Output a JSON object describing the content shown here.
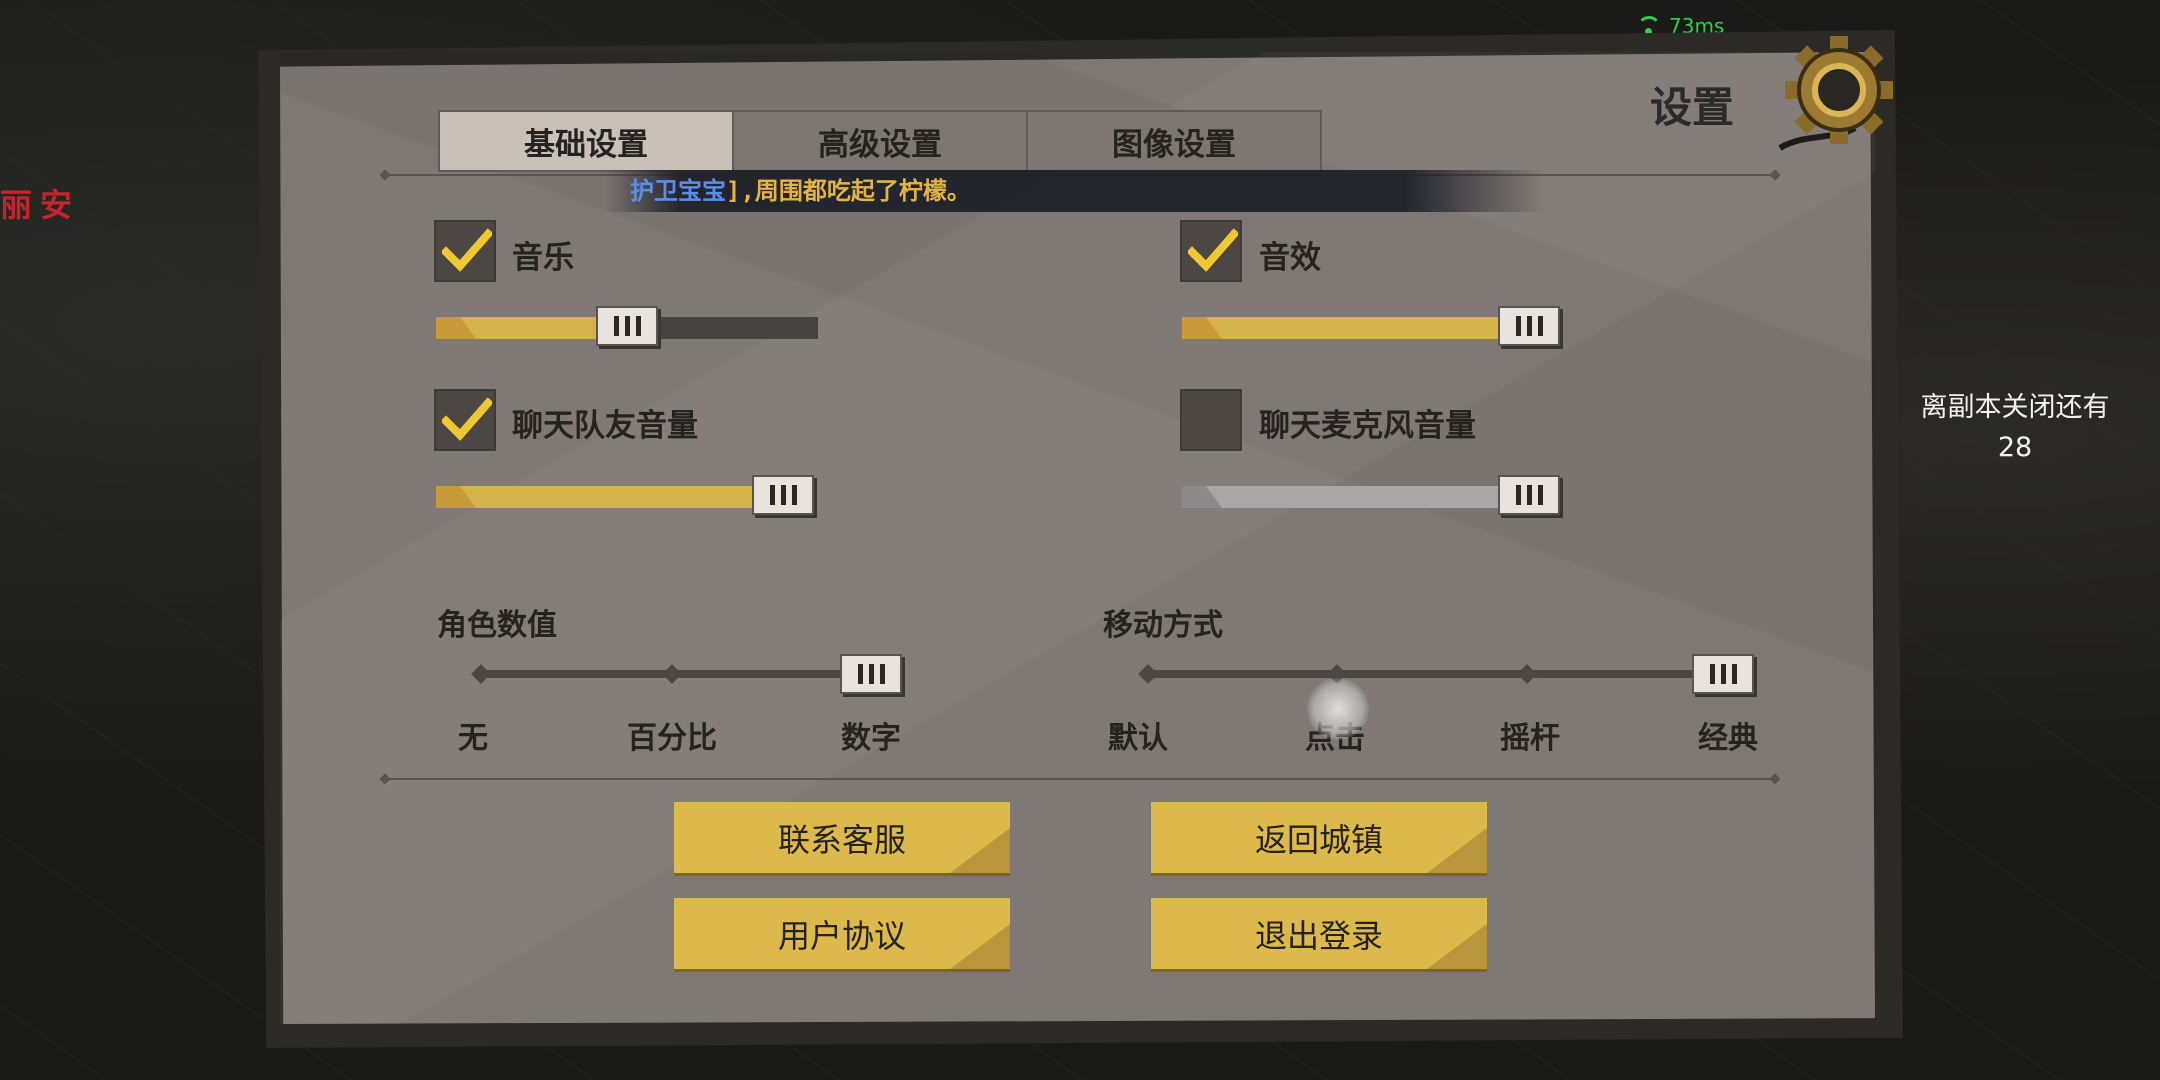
{
  "status": {
    "ping": "73ms"
  },
  "world": {
    "player_name_fragment": "丽安",
    "countdown_label": "离副本关闭还有",
    "countdown_value": "28"
  },
  "panel": {
    "title": "设置",
    "tabs": [
      {
        "label": "基础设置",
        "active": true
      },
      {
        "label": "高级设置",
        "active": false
      },
      {
        "label": "图像设置",
        "active": false
      }
    ],
    "ticker": {
      "name": "护卫宝宝",
      "message": "],周围都吃起了柠檬。"
    },
    "audio": {
      "music": {
        "label": "音乐",
        "checked": true,
        "level": 0.48
      },
      "sfx": {
        "label": "音效",
        "checked": true,
        "level": 1.0
      },
      "chat_teammate": {
        "label": "聊天队友音量",
        "checked": true,
        "level": 0.92
      },
      "chat_mic": {
        "label": "聊天麦克风音量",
        "checked": false,
        "level": 1.0
      }
    },
    "role_values": {
      "title": "角色数值",
      "options": [
        "无",
        "百分比",
        "数字"
      ],
      "selected": "数字"
    },
    "movement": {
      "title": "移动方式",
      "options": [
        "默认",
        "点击",
        "摇杆",
        "经典"
      ],
      "selected": "经典"
    },
    "buttons": {
      "contact": "联系客服",
      "return_town": "返回城镇",
      "agreement": "用户协议",
      "logout": "退出登录"
    }
  },
  "colors": {
    "panel": "#7f7874",
    "accent_yellow": "#dcb94a",
    "check_yellow": "#f2c832",
    "ping_green": "#2ecc4f"
  }
}
